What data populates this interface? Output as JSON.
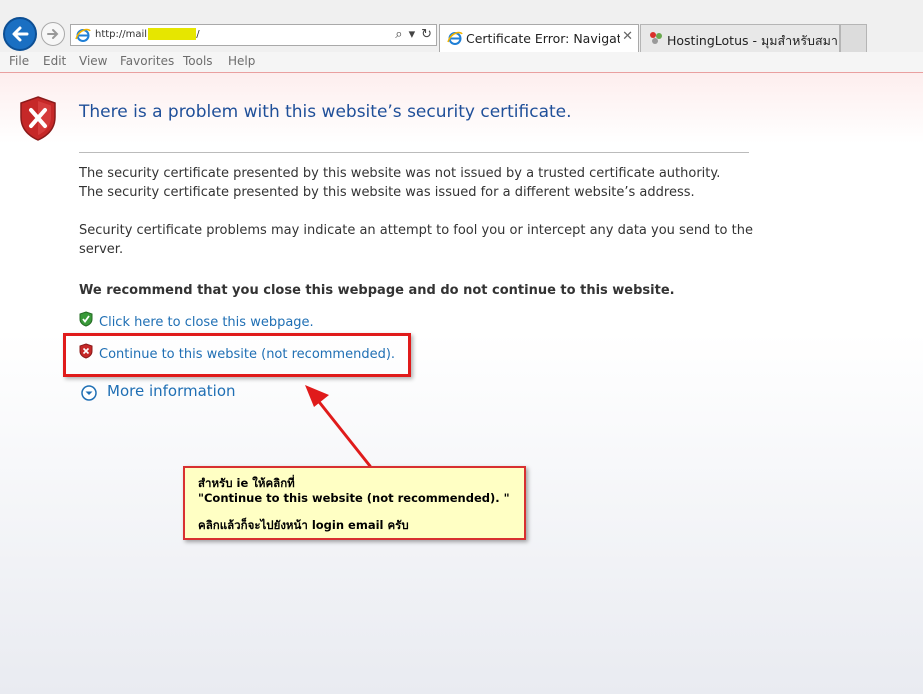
{
  "browser": {
    "address": "http://mail.",
    "address_tail": "/",
    "tabs": [
      {
        "label": "Certificate Error: Navigation...",
        "close": "✕"
      },
      {
        "label": "HostingLotus - มุมสำหรับสมาชิก"
      }
    ],
    "menu": [
      "File",
      "Edit",
      "View",
      "Favorites",
      "Tools",
      "Help"
    ]
  },
  "page": {
    "title": "There is a problem with this website’s security certificate.",
    "lines": [
      "The security certificate presented by this website was not issued by a trusted certificate authority.",
      "The security certificate presented by this website was issued for a different website’s address."
    ],
    "warning_line1": "Security certificate problems may indicate an attempt to fool you or intercept any data you send to the",
    "warning_line2": "server.",
    "recommend": "We recommend that you close this webpage and do not continue to this website.",
    "close_link": "Click here to close this webpage.",
    "continue_link": "Continue to this website (not recommended).",
    "more_info": "More information"
  },
  "annotation": {
    "line1": "สำหรับ ie ให้คลิกที่",
    "line2": "\"Continue to this website (not recommended). \"",
    "line3": "คลิกแล้วก็จะไปยังหน้า login email ครับ"
  },
  "colors": {
    "link": "#1f6fb4",
    "title": "#1f4f99",
    "highlight_box": "#e01b1b",
    "note_bg": "#ffffc4"
  }
}
